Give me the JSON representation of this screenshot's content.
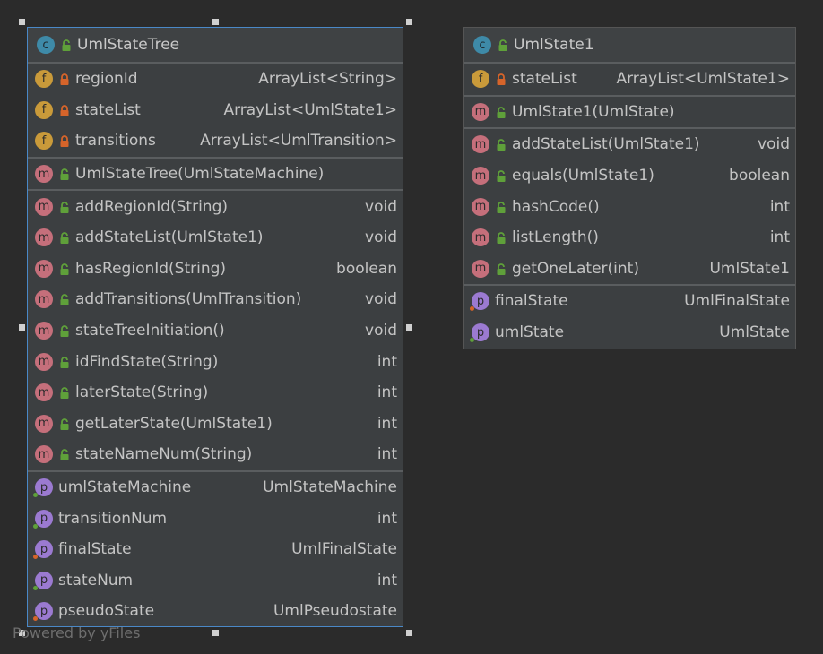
{
  "footer": "Powered by yFiles",
  "colors": {
    "background": "#2b2b2b",
    "node": "#3c3f41",
    "selection": "#4a88c7",
    "class_badge": "#3e8aa8",
    "field_badge": "#c99a3a",
    "method_badge": "#c56f7b",
    "property_badge": "#9b7ad1",
    "lock_private": "#d6642a",
    "lock_public": "#5fa03a"
  },
  "nodes": [
    {
      "id": "UmlStateTree",
      "badge": "c",
      "title": "UmlStateTree",
      "selected": true,
      "sections": [
        [
          {
            "kind": "f",
            "vis": "private",
            "name": "regionId",
            "type": "ArrayList<String>"
          },
          {
            "kind": "f",
            "vis": "private",
            "name": "stateList",
            "type": "ArrayList<UmlState1>"
          },
          {
            "kind": "f",
            "vis": "private",
            "name": "transitions",
            "type": "ArrayList<UmlTransition>"
          }
        ],
        [
          {
            "kind": "m",
            "vis": "public",
            "name": "UmlStateTree(UmlStateMachine)",
            "type": ""
          }
        ],
        [
          {
            "kind": "m",
            "vis": "public",
            "name": "addRegionId(String)",
            "type": "void"
          },
          {
            "kind": "m",
            "vis": "public",
            "name": "addStateList(UmlState1)",
            "type": "void"
          },
          {
            "kind": "m",
            "vis": "public",
            "name": "hasRegionId(String)",
            "type": "boolean"
          },
          {
            "kind": "m",
            "vis": "public",
            "name": "addTransitions(UmlTransition)",
            "type": "void"
          },
          {
            "kind": "m",
            "vis": "public",
            "name": "stateTreeInitiation()",
            "type": "void"
          },
          {
            "kind": "m",
            "vis": "public",
            "name": "idFindState(String)",
            "type": "int"
          },
          {
            "kind": "m",
            "vis": "public",
            "name": "laterState(String)",
            "type": "int"
          },
          {
            "kind": "m",
            "vis": "public",
            "name": "getLaterState(UmlState1)",
            "type": "int"
          },
          {
            "kind": "m",
            "vis": "public",
            "name": "stateNameNum(String)",
            "type": "int"
          }
        ],
        [
          {
            "kind": "p",
            "vis": "green",
            "name": "umlStateMachine",
            "type": "UmlStateMachine"
          },
          {
            "kind": "p",
            "vis": "green",
            "name": "transitionNum",
            "type": "int"
          },
          {
            "kind": "p",
            "vis": "orange",
            "name": "finalState",
            "type": "UmlFinalState"
          },
          {
            "kind": "p",
            "vis": "green",
            "name": "stateNum",
            "type": "int"
          },
          {
            "kind": "p",
            "vis": "orange",
            "name": "pseudoState",
            "type": "UmlPseudostate"
          }
        ]
      ]
    },
    {
      "id": "UmlState1",
      "badge": "c",
      "title": "UmlState1",
      "selected": false,
      "sections": [
        [
          {
            "kind": "f",
            "vis": "private",
            "name": "stateList",
            "type": "ArrayList<UmlState1>"
          }
        ],
        [
          {
            "kind": "m",
            "vis": "public",
            "name": "UmlState1(UmlState)",
            "type": ""
          }
        ],
        [
          {
            "kind": "m",
            "vis": "public",
            "name": "addStateList(UmlState1)",
            "type": "void"
          },
          {
            "kind": "m",
            "vis": "public",
            "name": "equals(UmlState1)",
            "type": "boolean"
          },
          {
            "kind": "m",
            "vis": "public",
            "name": "hashCode()",
            "type": "int"
          },
          {
            "kind": "m",
            "vis": "public",
            "name": "listLength()",
            "type": "int"
          },
          {
            "kind": "m",
            "vis": "public",
            "name": "getOneLater(int)",
            "type": "UmlState1"
          }
        ],
        [
          {
            "kind": "p",
            "vis": "orange",
            "name": "finalState",
            "type": "UmlFinalState"
          },
          {
            "kind": "p",
            "vis": "green",
            "name": "umlState",
            "type": "UmlState"
          }
        ]
      ]
    }
  ]
}
